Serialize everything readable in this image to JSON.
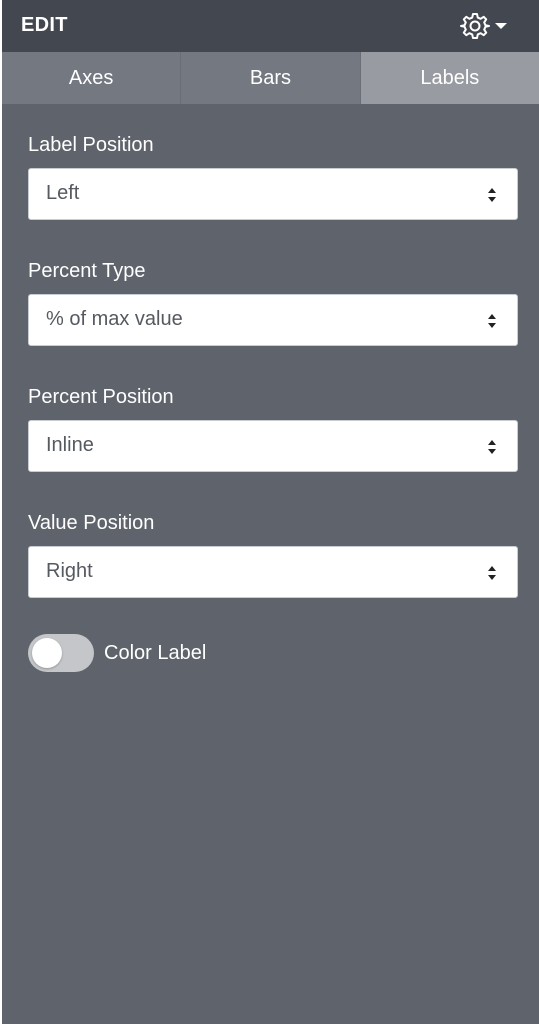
{
  "header": {
    "title": "EDIT",
    "settings_icon": "gear-icon",
    "menu_icon": "caret-down-icon"
  },
  "tabs": [
    {
      "label": "Axes",
      "active": false
    },
    {
      "label": "Bars",
      "active": false
    },
    {
      "label": "Labels",
      "active": true
    }
  ],
  "fields": {
    "label_position": {
      "label": "Label Position",
      "value": "Left"
    },
    "percent_type": {
      "label": "Percent Type",
      "value": "% of max value"
    },
    "percent_position": {
      "label": "Percent Position",
      "value": "Inline"
    },
    "value_position": {
      "label": "Value Position",
      "value": "Right"
    }
  },
  "color_label": {
    "label": "Color Label",
    "enabled": false
  },
  "colors": {
    "panel_background": "#5f646c",
    "header_background": "#43474f",
    "tab_background": "#747880",
    "tab_active_background": "#989ca2",
    "toggle_off": "#c4c6ca"
  }
}
